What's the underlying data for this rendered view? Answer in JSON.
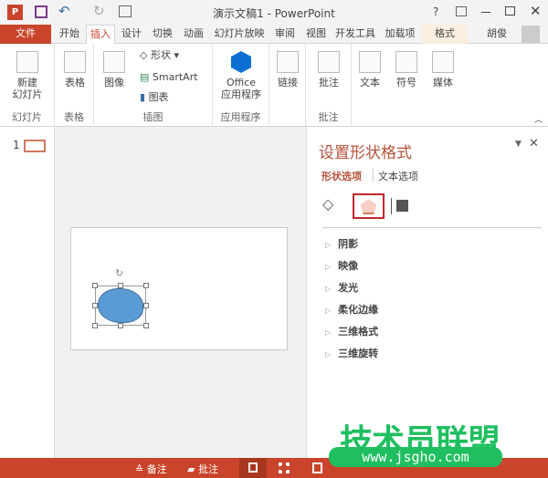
{
  "title": "演示文稿1 - PowerPoint",
  "user": "胡俊",
  "tabs": [
    "文件",
    "开始",
    "插入",
    "设计",
    "切换",
    "动画",
    "幻灯片放映",
    "审阅",
    "视图",
    "开发工具",
    "加载项",
    "格式"
  ],
  "active_tab": "插入",
  "ribbon": {
    "new_slide": "新建\n幻灯片",
    "table": "表格",
    "image": "图像",
    "shape": "形状",
    "smartart": "SmartArt",
    "chart": "图表",
    "office": "Office",
    "apps": "应用程序",
    "link": "链接",
    "comment": "批注",
    "text": "文本",
    "symbol": "符号",
    "media": "媒体",
    "groups": [
      "幻灯片",
      "表格",
      "插图",
      "应用程序",
      "批注"
    ]
  },
  "slide_number": "1",
  "pane": {
    "title": "设置形状格式",
    "tab_shape": "形状选项",
    "tab_text": "文本选项",
    "items": [
      "阴影",
      "映像",
      "发光",
      "柔化边缘",
      "三维格式",
      "三维旋转"
    ]
  },
  "status": {
    "notes": "备注",
    "comments": "批注"
  },
  "watermark": {
    "title": "技术员联盟",
    "url": "www.jsgho.com"
  },
  "colors": {
    "accent": "#c9442a",
    "shape_fill": "#5b9bd5",
    "watermark": "#1fbf5f"
  }
}
